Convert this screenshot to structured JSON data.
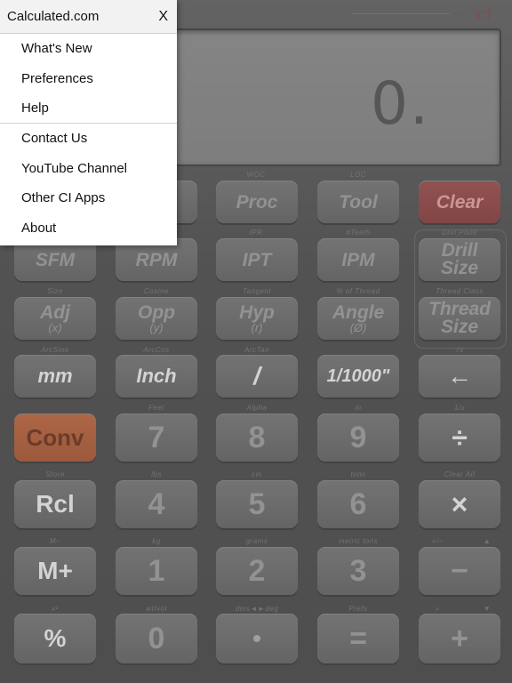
{
  "app": {
    "brand_logo": "ci",
    "brand_small": "pro",
    "display_value": "0."
  },
  "menu": {
    "title": "Calculated.com",
    "close_label": "X",
    "groups": [
      [
        "What's New",
        "Preferences",
        "Help"
      ],
      [
        "Contact Us",
        "YouTube Channel",
        "Other CI Apps",
        "About"
      ]
    ]
  },
  "keys": {
    "row1": {
      "labels": [
        "",
        "",
        "WOC",
        "LOC",
        ""
      ],
      "buttons": [
        "",
        "",
        "Proc",
        "Tool",
        "Clear"
      ]
    },
    "row2": {
      "labels": [
        "",
        "",
        "IPR",
        "#Teeth",
        "Drill Point"
      ],
      "buttons": [
        "SFM",
        "RPM",
        "IPT",
        "IPM",
        "Drill Size"
      ]
    },
    "row3": {
      "labels": [
        "Size",
        "Cosine",
        "Tangent",
        "% of Thread",
        "Thread Class"
      ],
      "buttons": [
        "Adj",
        "Opp",
        "Hyp",
        "Angle",
        "Thread Size"
      ],
      "subs": [
        "(x)",
        "(y)",
        "(r)",
        "(Ø)",
        ""
      ]
    },
    "row4": {
      "labels": [
        "ArcSine",
        "ArcCos",
        "ArcTan",
        "",
        "√x"
      ],
      "buttons": [
        "mm",
        "Inch",
        "/",
        "1/1000\"",
        "←"
      ]
    },
    "row5": {
      "labels": [
        "",
        "Feet",
        "Alpha",
        "m",
        "1/x"
      ],
      "buttons": [
        "Conv",
        "7",
        "8",
        "9",
        "÷"
      ]
    },
    "row6": {
      "labels": [
        "Store",
        "lbs",
        "cm",
        "tons",
        "Clear All"
      ],
      "buttons": [
        "Rcl",
        "4",
        "5",
        "6",
        "×"
      ]
    },
    "row7": {
      "labels": [
        "M−",
        "kg",
        "grams",
        "metric tons",
        "+/−"
      ],
      "buttons": [
        "M+",
        "1",
        "2",
        "3",
        "−"
      ],
      "corner": "▲"
    },
    "row8": {
      "labels": [
        "x²",
        "wt/vol",
        "dms◄►deg",
        "Prefs",
        "»"
      ],
      "buttons": [
        "%",
        "0",
        "•",
        "=",
        "+"
      ],
      "corner": "▼"
    }
  },
  "colors": {
    "clear_key": "#9b5757",
    "conv_key": "#b86e4c",
    "menu_background": "#ffffff"
  }
}
